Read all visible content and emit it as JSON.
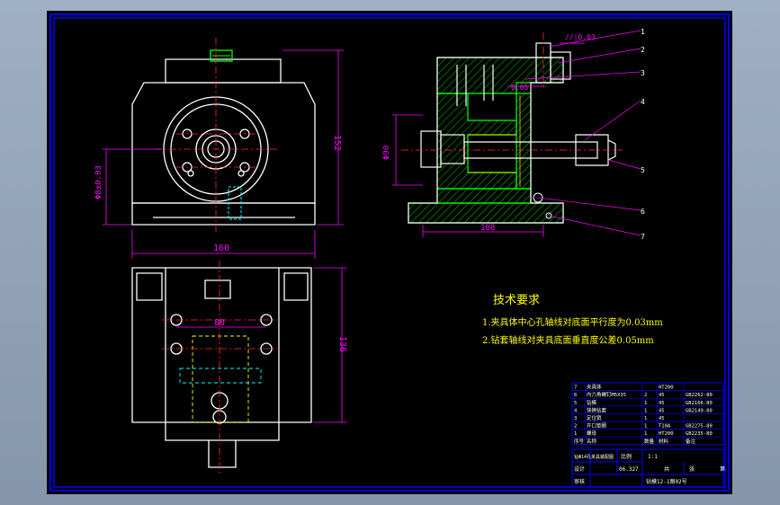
{
  "dimensions": {
    "front_height": "152",
    "front_dia": "Φ8±0.03",
    "front_width": "160",
    "side_dia": "Φ90",
    "side_len": "108",
    "top_par": "//|0.03",
    "side_val": "0.05",
    "top_hole": "80",
    "top_height": "136"
  },
  "balloons": [
    "1",
    "2",
    "3",
    "4",
    "5",
    "6",
    "7"
  ],
  "tech_requirements": {
    "title": "技术要求",
    "items": [
      "1.夹具体中心孔轴线对底面平行度为0.03mm",
      "2.钻套轴线对夹具底面垂直度公差0.05mm"
    ]
  },
  "bom": [
    {
      "no": "7",
      "name": "夹具体",
      "qty": "",
      "material": "HT200",
      "std": ""
    },
    {
      "no": "6",
      "name": "内六角螺钉M5X35",
      "qty": "2",
      "material": "45",
      "std": "GB2262-80"
    },
    {
      "no": "5",
      "name": "钻模",
      "qty": "1",
      "material": "45",
      "std": "GB2166-80"
    },
    {
      "no": "4",
      "name": "快换钻套",
      "qty": "1",
      "material": "45",
      "std": "GB2149-80"
    },
    {
      "no": "3",
      "name": "定位销",
      "qty": "1",
      "material": "45",
      "std": ""
    },
    {
      "no": "2",
      "name": "开口垫圈",
      "qty": "1",
      "material": "T10A",
      "std": "GB2275-80"
    },
    {
      "no": "1",
      "name": "螺母",
      "qty": "1",
      "material": "HT200",
      "std": "GB2235-80"
    }
  ],
  "bom_header": {
    "no": "序号",
    "name": "名称",
    "qty": "数量",
    "material": "材料",
    "std": "备注"
  },
  "title_block": {
    "drawing_title": "钻Φ14孔夹具装配图",
    "scale_label": "比例",
    "scale_value": "1:1",
    "designer_label": "设计",
    "designer_date": "06.327",
    "checker_label": "审核",
    "sheet_label": "共",
    "sheet_label2": "张",
    "side_label": "第",
    "part_no": "钻模12-1图02号"
  },
  "colors": {
    "screen_bg": "#8596ab",
    "sheet_bg": "#000000",
    "frame": "#0000ff",
    "outline": "#ffffff",
    "dimension": "#ff00ff",
    "hatch": "#00ff00",
    "centerline": "#ff3030",
    "text_yellow": "#ffff00",
    "hidden": "#00ffff"
  }
}
